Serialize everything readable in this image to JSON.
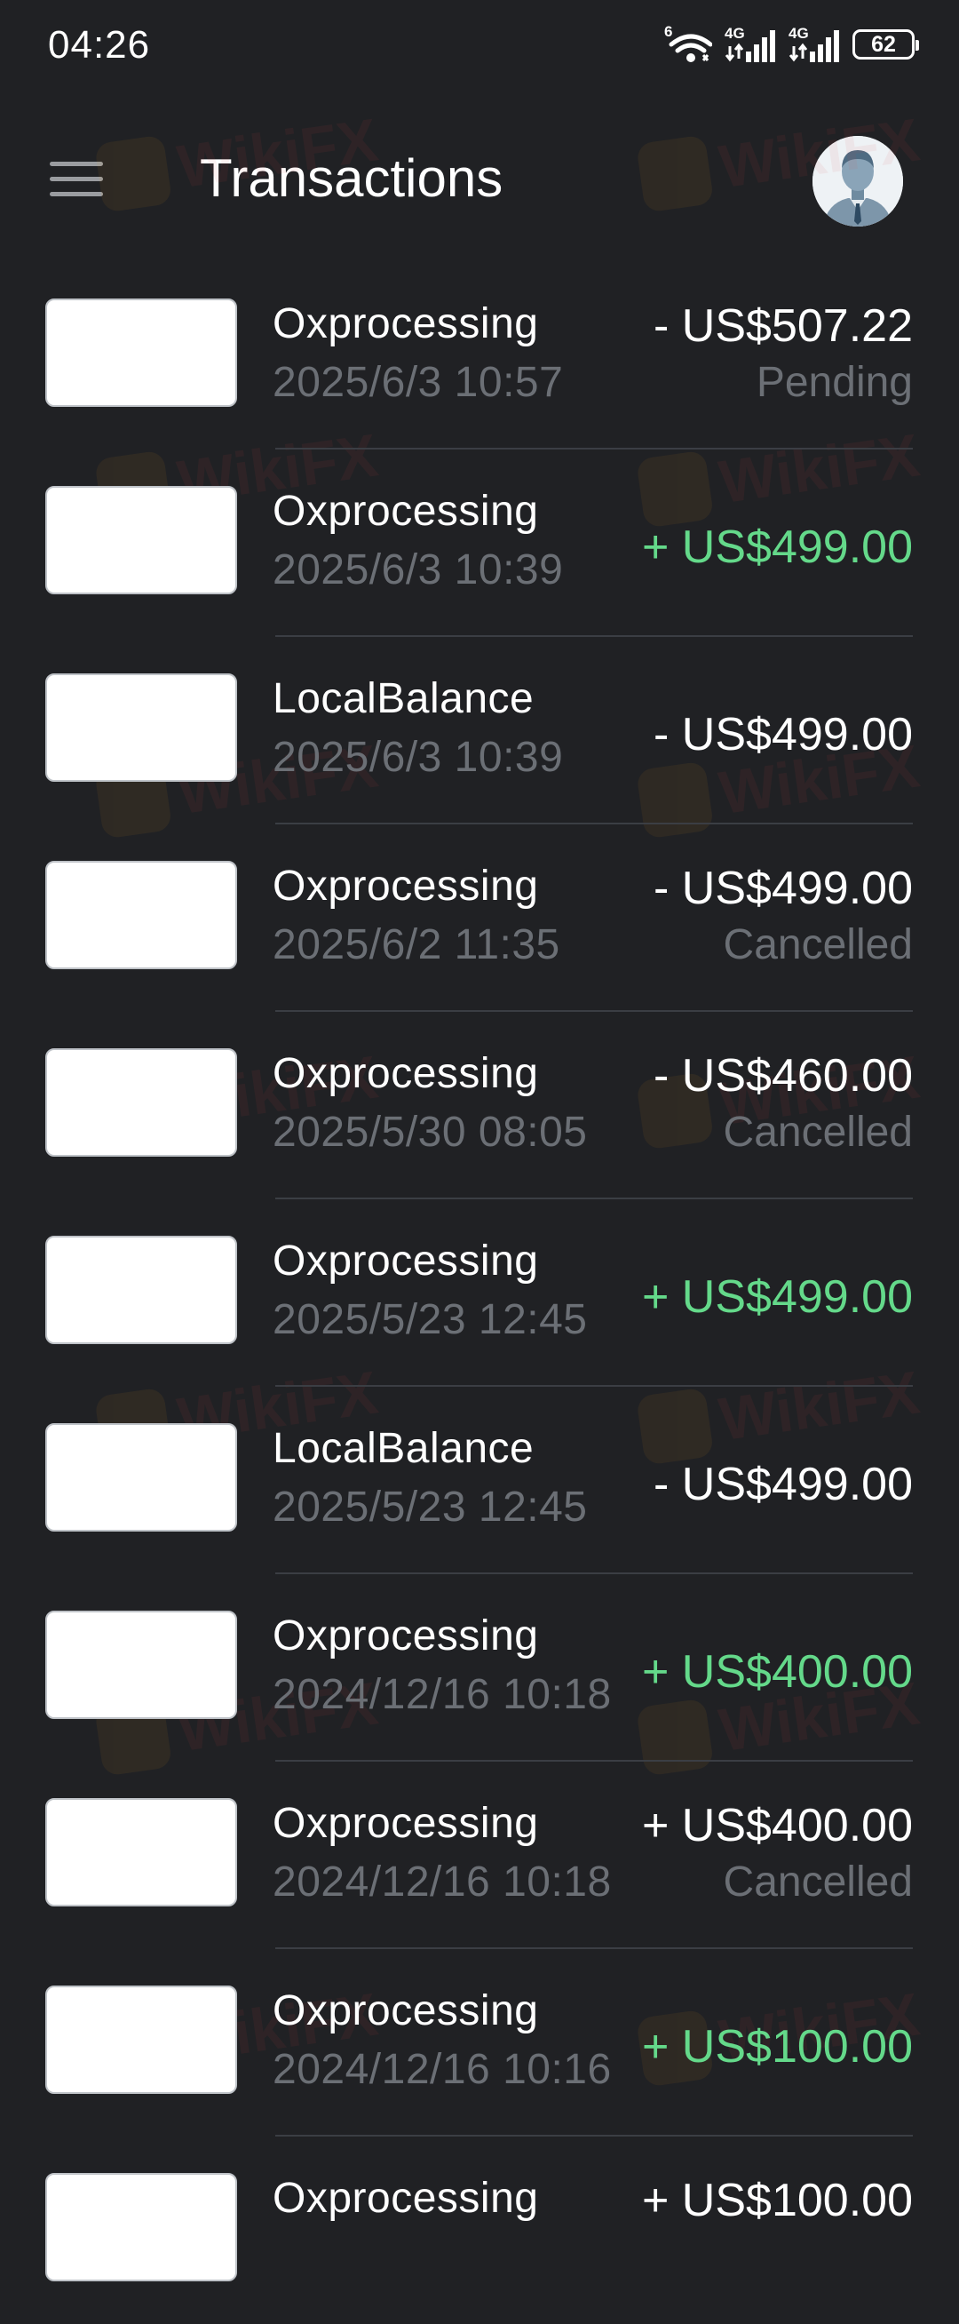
{
  "status_bar": {
    "time": "04:26",
    "network_1": "4G",
    "network_2": "4G",
    "wifi_tag": "6",
    "battery": "62"
  },
  "header": {
    "title": "Transactions"
  },
  "colors": {
    "background": "#202124",
    "credit": "#64d98a",
    "muted_text": "#6b6f75",
    "divider": "#3b3e44"
  },
  "watermark_text": "WikiFX",
  "transactions": [
    {
      "name": "Oxprocessing",
      "date": "2025/6/3 10:57",
      "amount": "- US$507.22",
      "status": "Pending"
    },
    {
      "name": "Oxprocessing",
      "date": "2025/6/3 10:39",
      "amount": "+ US$499.00",
      "status": ""
    },
    {
      "name": "LocalBalance",
      "date": "2025/6/3 10:39",
      "amount": "- US$499.00",
      "status": ""
    },
    {
      "name": "Oxprocessing",
      "date": "2025/6/2 11:35",
      "amount": "- US$499.00",
      "status": "Cancelled"
    },
    {
      "name": "Oxprocessing",
      "date": "2025/5/30 08:05",
      "amount": "- US$460.00",
      "status": "Cancelled"
    },
    {
      "name": "Oxprocessing",
      "date": "2025/5/23 12:45",
      "amount": "+ US$499.00",
      "status": ""
    },
    {
      "name": "LocalBalance",
      "date": "2025/5/23 12:45",
      "amount": "- US$499.00",
      "status": ""
    },
    {
      "name": "Oxprocessing",
      "date": "2024/12/16 10:18",
      "amount": "+ US$400.00",
      "status": ""
    },
    {
      "name": "Oxprocessing",
      "date": "2024/12/16 10:18",
      "amount": "+ US$400.00",
      "status": "Cancelled"
    },
    {
      "name": "Oxprocessing",
      "date": "2024/12/16 10:16",
      "amount": "+ US$100.00",
      "status": ""
    },
    {
      "name": "Oxprocessing",
      "date": "",
      "amount": "+ US$100.00",
      "status": ""
    }
  ]
}
